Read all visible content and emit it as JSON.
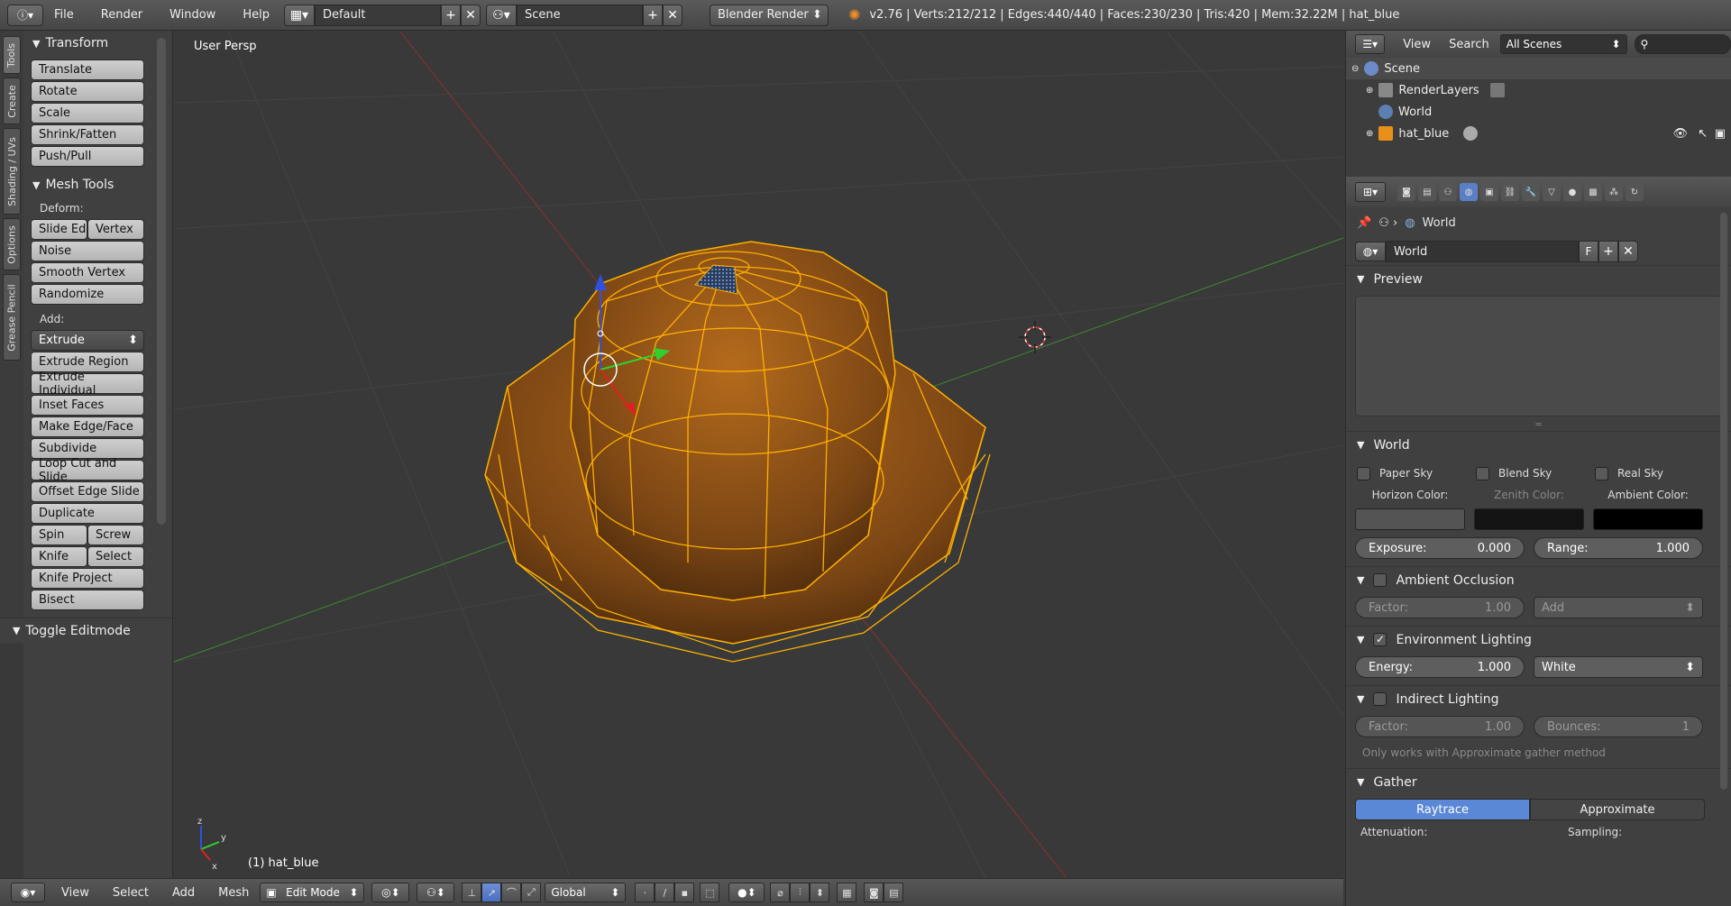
{
  "topbar": {
    "menus": [
      "File",
      "Render",
      "Window",
      "Help"
    ],
    "screen_layout": "Default",
    "scene": "Scene",
    "render_engine": "Blender Render",
    "stats": "v2.76 | Verts:212/212 | Edges:440/440 | Faces:230/230 | Tris:420 | Mem:32.22M | hat_blue"
  },
  "tabs": [
    "Tools",
    "Create",
    "Shading / UVs",
    "Options",
    "Grease Pencil"
  ],
  "shelf": {
    "transform_title": "Transform",
    "transform_buttons": [
      "Translate",
      "Rotate",
      "Scale",
      "Shrink/Fatten",
      "Push/Pull"
    ],
    "mesh_tools_title": "Mesh Tools",
    "deform_label": "Deform:",
    "slide_edge": "Slide Ed",
    "slide_vertex": "Vertex",
    "deform_buttons": [
      "Noise",
      "Smooth Vertex",
      "Randomize"
    ],
    "add_label": "Add:",
    "extrude_dropdown": "Extrude",
    "add_buttons": [
      "Extrude Region",
      "Extrude Individual",
      "Inset Faces",
      "Make Edge/Face",
      "Subdivide",
      "Loop Cut and Slide",
      "Offset Edge Slide",
      "Duplicate"
    ],
    "spin": "Spin",
    "screw": "Screw",
    "knife": "Knife",
    "select": "Select",
    "more_buttons": [
      "Knife Project",
      "Bisect"
    ],
    "toggle_editmode": "Toggle Editmode"
  },
  "viewport": {
    "view_label": "User Persp",
    "object_label": "(1) hat_blue",
    "mesh_color": "#e8901a",
    "wire_color": "#ffb000"
  },
  "viewport_header": {
    "menus": [
      "View",
      "Select",
      "Add",
      "Mesh"
    ],
    "mode": "Edit Mode",
    "orientation": "Global"
  },
  "outliner": {
    "menus": [
      "View",
      "Search"
    ],
    "filter": "All Scenes",
    "items": [
      "Scene",
      "RenderLayers",
      "World",
      "hat_blue"
    ]
  },
  "properties": {
    "breadcrumb": "World",
    "world_name": "World",
    "fake_user": "F",
    "preview_title": "Preview",
    "world_title": "World",
    "checks": [
      "Paper Sky",
      "Blend Sky",
      "Real Sky"
    ],
    "horizon_label": "Horizon Color:",
    "zenith_label": "Zenith Color:",
    "ambient_label": "Ambient Color:",
    "exposure": {
      "label": "Exposure:",
      "value": "0.000"
    },
    "range": {
      "label": "Range:",
      "value": "1.000"
    },
    "ao_title": "Ambient Occlusion",
    "ao_factor": {
      "label": "Factor:",
      "value": "1.00"
    },
    "ao_mode": "Add",
    "env_title": "Environment Lighting",
    "env_energy": {
      "label": "Energy:",
      "value": "1.000"
    },
    "env_color": "White",
    "indirect_title": "Indirect Lighting",
    "ind_factor": {
      "label": "Factor:",
      "value": "1.00"
    },
    "ind_bounces": {
      "label": "Bounces:",
      "value": "1"
    },
    "indirect_note": "Only works with Approximate gather method",
    "gather_title": "Gather",
    "gather_options": [
      "Raytrace",
      "Approximate"
    ],
    "attenuation": "Attenuation:",
    "sampling": "Sampling:"
  }
}
